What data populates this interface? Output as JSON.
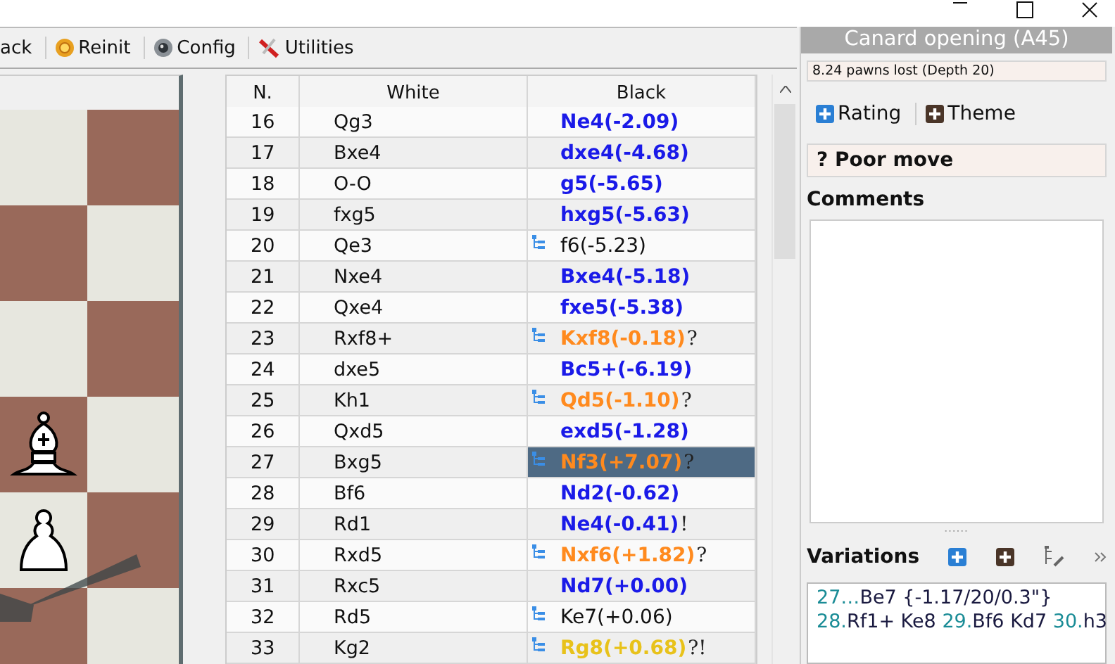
{
  "toolbar": [
    {
      "label": "ack"
    },
    {
      "label": "Reinit"
    },
    {
      "label": "Config"
    },
    {
      "label": "Utilities"
    }
  ],
  "moves": {
    "columns": [
      "N.",
      "White",
      "Black"
    ],
    "rows": [
      {
        "number": "16",
        "white": "Qg3",
        "black": "Ne4(-2.09)",
        "kind": "good",
        "variation": false,
        "selected": false
      },
      {
        "number": "17",
        "white": "Bxe4",
        "black": "dxe4(-4.68)",
        "kind": "good",
        "variation": false,
        "selected": false
      },
      {
        "number": "18",
        "white": "O-O",
        "black": "g5(-5.65)",
        "kind": "good",
        "variation": false,
        "selected": false
      },
      {
        "number": "19",
        "white": "fxg5",
        "black": "hxg5(-5.63)",
        "kind": "good",
        "variation": false,
        "selected": false
      },
      {
        "number": "20",
        "white": "Qe3",
        "black": "f6(-5.23)",
        "kind": "plain",
        "variation": true,
        "selected": false
      },
      {
        "number": "21",
        "white": "Nxe4",
        "black": "Bxe4(-5.18)",
        "kind": "good",
        "variation": false,
        "selected": false
      },
      {
        "number": "22",
        "white": "Qxe4",
        "black": "fxe5(-5.38)",
        "kind": "good",
        "variation": false,
        "selected": false
      },
      {
        "number": "23",
        "white": "Rxf8+",
        "black": "Kxf8(-0.18)",
        "annotation": "?",
        "kind": "mistake",
        "variation": true,
        "selected": false
      },
      {
        "number": "24",
        "white": "dxe5",
        "black": "Bc5+(-6.19)",
        "kind": "good",
        "variation": false,
        "selected": false
      },
      {
        "number": "25",
        "white": "Kh1",
        "black": "Qd5(-1.10)",
        "annotation": "?",
        "kind": "mistake",
        "variation": true,
        "selected": false
      },
      {
        "number": "26",
        "white": "Qxd5",
        "black": "exd5(-1.28)",
        "kind": "good",
        "variation": false,
        "selected": false
      },
      {
        "number": "27",
        "white": "Bxg5",
        "black": "Nf3(+7.07)",
        "annotation": "?",
        "kind": "mistake",
        "variation": true,
        "selected": true
      },
      {
        "number": "28",
        "white": "Bf6",
        "black": "Nd2(-0.62)",
        "kind": "good",
        "variation": false,
        "selected": false
      },
      {
        "number": "29",
        "white": "Rd1",
        "black": "Ne4(-0.41)",
        "annotation": "!",
        "kind": "good",
        "variation": false,
        "selected": false
      },
      {
        "number": "30",
        "white": "Rxd5",
        "black": "Nxf6(+1.82)",
        "annotation": "?",
        "kind": "mistake",
        "variation": true,
        "selected": false
      },
      {
        "number": "31",
        "white": "Rxc5",
        "black": "Nd7(+0.00)",
        "kind": "good",
        "variation": false,
        "selected": false
      },
      {
        "number": "32",
        "white": "Rd5",
        "black": "Ke7(+0.06)",
        "kind": "plain",
        "variation": true,
        "selected": false
      },
      {
        "number": "33",
        "white": "Kg2",
        "black": "Rg8(+0.68)",
        "annotation": "?!",
        "kind": "dubious",
        "variation": true,
        "selected": false
      }
    ]
  },
  "panel": {
    "opening": "Canard opening (A45)",
    "evaluation": "8.24 pawns lost (Depth 20)",
    "buttons": [
      {
        "label": "Rating",
        "kind": "blue"
      },
      {
        "label": "Theme",
        "kind": "brown"
      }
    ],
    "judgement": "? Poor move",
    "comments_label": "Comments",
    "variations_label": "Variations",
    "variations": [
      [
        {
          "kind": "number",
          "text": "27…"
        },
        {
          "kind": "move",
          "text": "Be7 {-1.17/20/0.3\"}"
        }
      ],
      [
        {
          "kind": "number",
          "text": "28."
        },
        {
          "kind": "move",
          "text": "Rf1+ Ke8"
        },
        {
          "kind": "number",
          "text": "29."
        },
        {
          "kind": "move",
          "text": "Bf6 Kd7"
        },
        {
          "kind": "number",
          "text": "30."
        },
        {
          "kind": "move",
          "text": "h3"
        }
      ]
    ]
  }
}
